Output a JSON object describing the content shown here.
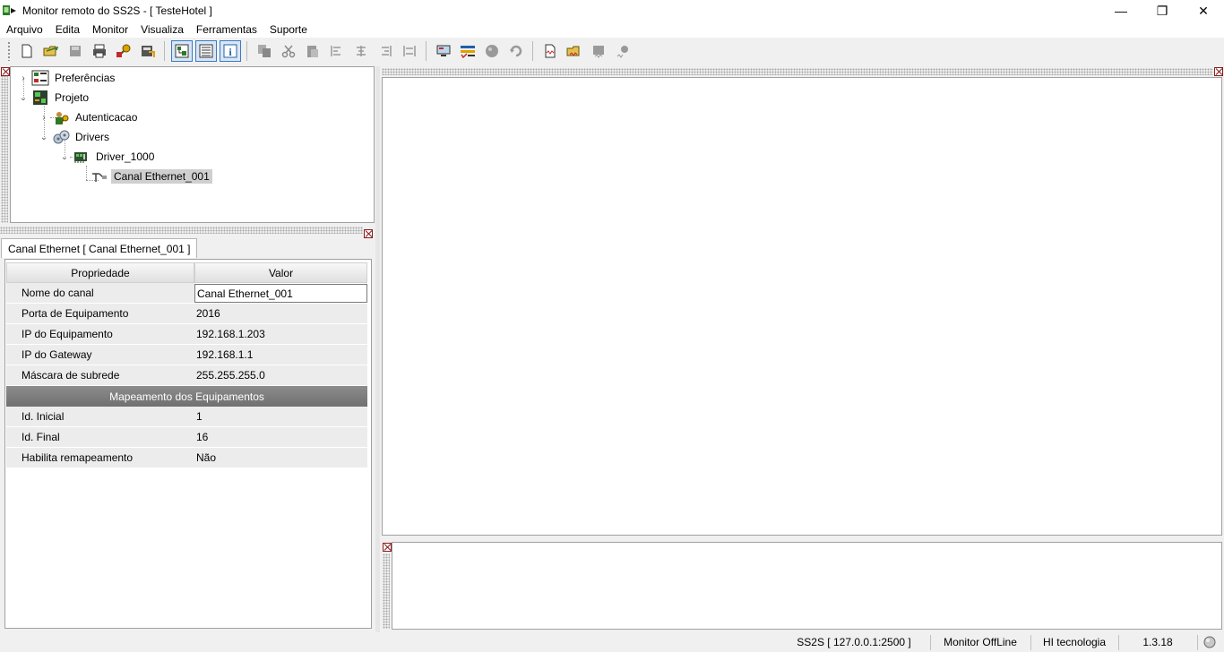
{
  "window": {
    "title": "Monitor remoto do SS2S - [ TesteHotel ]",
    "minimize": "—",
    "restore": "❐",
    "close": "✕"
  },
  "menu": [
    "Arquivo",
    "Edita",
    "Monitor",
    "Visualiza",
    "Ferramentas",
    "Suporte"
  ],
  "toolbar": {
    "icons": [
      "new-file-icon",
      "open-folder-icon",
      "save-icon",
      "print-icon",
      "key-config-icon",
      "export-icon",
      "tree-view-icon",
      "list-view-icon",
      "info-icon",
      "copy-icon",
      "cut-icon",
      "paste-icon",
      "align-left-icon",
      "align-center-icon",
      "align-right-icon",
      "align-justify-icon",
      "monitor-icon",
      "checklist-icon",
      "globe-icon",
      "refresh-icon",
      "wave-document-icon",
      "open-wave-icon",
      "save-wave-icon",
      "record-icon"
    ]
  },
  "tree": {
    "items": [
      {
        "label": "Preferências",
        "icon": "preferences-icon",
        "expander": "›"
      },
      {
        "label": "Projeto",
        "icon": "project-icon",
        "expander": "⌄"
      },
      {
        "label": "Autenticacao",
        "icon": "authentication-icon",
        "expander": "›"
      },
      {
        "label": "Drivers",
        "icon": "drivers-icon",
        "expander": "⌄"
      },
      {
        "label": "Driver_1000",
        "icon": "driver-icon",
        "expander": "⌄"
      },
      {
        "label": "Canal Ethernet_001",
        "icon": "ethernet-channel-icon",
        "expander": ""
      }
    ]
  },
  "properties": {
    "tab": "Canal Ethernet [ Canal Ethernet_001 ]",
    "header_property": "Propriedade",
    "header_value": "Valor",
    "rows": [
      {
        "k": "Nome do canal",
        "v": "Canal Ethernet_001"
      },
      {
        "k": "Porta de Equipamento",
        "v": "2016"
      },
      {
        "k": "IP do Equipamento",
        "v": "192.168.1.203"
      },
      {
        "k": "IP do Gateway",
        "v": "192.168.1.1"
      },
      {
        "k": "Máscara de subrede",
        "v": "255.255.255.0"
      }
    ],
    "section": "Mapeamento dos Equipamentos",
    "rows2": [
      {
        "k": "Id. Inicial",
        "v": "1"
      },
      {
        "k": "Id. Final",
        "v": "16"
      },
      {
        "k": "Habilita remapeamento",
        "v": "Não"
      }
    ]
  },
  "status": {
    "server": "SS2S [ 127.0.0.1:2500 ]",
    "monitor": "Monitor OffLine",
    "company": "HI tecnologia",
    "version": "1.3.18"
  }
}
